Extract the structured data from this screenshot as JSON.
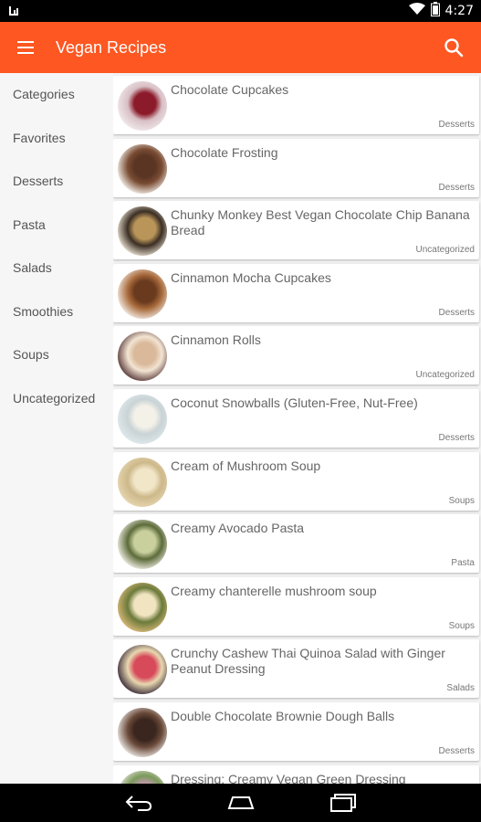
{
  "status_bar": {
    "time": "4:27",
    "icons": [
      "notification-icon",
      "wifi-icon",
      "battery-icon"
    ]
  },
  "app_bar": {
    "title": "Vegan Recipes",
    "menu_icon": "hamburger-menu-icon",
    "search_icon": "search-icon",
    "color": "#fe5722"
  },
  "sidebar": {
    "items": [
      {
        "label": "Categories"
      },
      {
        "label": "Favorites"
      },
      {
        "label": "Desserts"
      },
      {
        "label": "Pasta"
      },
      {
        "label": "Salads"
      },
      {
        "label": "Smoothies"
      },
      {
        "label": "Soups"
      },
      {
        "label": "Uncategorized"
      }
    ]
  },
  "recipes": [
    {
      "name": "Chocolate Cupcakes",
      "category": "Desserts",
      "thumb_colors": [
        "#f0e8ea",
        "#8b1a2a",
        "#d8c0c5"
      ]
    },
    {
      "name": "Chocolate Frosting",
      "category": "Desserts",
      "thumb_colors": [
        "#f4f0ea",
        "#5a3524",
        "#7a4c33"
      ]
    },
    {
      "name": "Chunky Monkey Best Vegan Chocolate Chip Banana Bread",
      "category": "Uncategorized",
      "thumb_colors": [
        "#e8e0d0",
        "#b99559",
        "#3b2e24"
      ]
    },
    {
      "name": "Cinnamon Mocha Cupcakes",
      "category": "Desserts",
      "thumb_colors": [
        "#f3e8e0",
        "#6a3a1e",
        "#a86b3c"
      ]
    },
    {
      "name": "Cinnamon Rolls",
      "category": "Uncategorized",
      "thumb_colors": [
        "#5a3a3a",
        "#d9b99a",
        "#f2e4d2"
      ]
    },
    {
      "name": "Coconut Snowballs (Gluten-Free, Nut-Free)",
      "category": "Desserts",
      "thumb_colors": [
        "#dfe8ea",
        "#f4f1e8",
        "#c9d3d6"
      ]
    },
    {
      "name": "Cream of Mushroom Soup",
      "category": "Soups",
      "thumb_colors": [
        "#e6d6b0",
        "#f1e6c8",
        "#cdb88a"
      ]
    },
    {
      "name": "Creamy Avocado Pasta",
      "category": "Pasta",
      "thumb_colors": [
        "#f2efe4",
        "#c9d09e",
        "#5c6b3a"
      ]
    },
    {
      "name": "Creamy chanterelle mushroom soup",
      "category": "Soups",
      "thumb_colors": [
        "#d8b878",
        "#f1e4c0",
        "#6b7a3a"
      ]
    },
    {
      "name": "Crunchy Cashew Thai Quinoa Salad with Ginger Peanut Dressing",
      "category": "Salads",
      "thumb_colors": [
        "#3a2c3a",
        "#d64a5a",
        "#e8d8b0"
      ]
    },
    {
      "name": "Double Chocolate Brownie Dough Balls",
      "category": "Desserts",
      "thumb_colors": [
        "#eae6e2",
        "#3a261e",
        "#6b4a3a"
      ]
    },
    {
      "name": "Dressing: Creamy Vegan Green Dressing",
      "category": "",
      "thumb_colors": [
        "#e8e4de",
        "#b89aa0",
        "#7a9a5a"
      ]
    }
  ],
  "nav_bar": {
    "back_icon": "back-icon",
    "home_icon": "home-icon",
    "recents_icon": "recents-icon"
  }
}
